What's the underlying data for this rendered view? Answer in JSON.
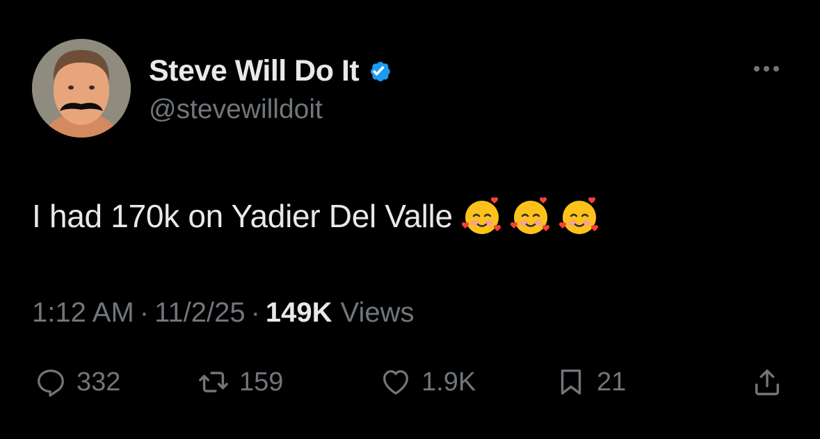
{
  "author": {
    "display_name": "Steve Will Do It",
    "handle": "@stevewilldoit",
    "verified": true,
    "verified_color": "#1d9bf0"
  },
  "tweet": {
    "text": "I had 170k on Yadier Del Valle",
    "emojis": [
      "smiling-face-with-hearts",
      "smiling-face-with-hearts",
      "smiling-face-with-hearts"
    ]
  },
  "meta": {
    "time": "1:12 AM",
    "date": "11/2/25",
    "separator": "·",
    "views_count": "149K",
    "views_label": "Views"
  },
  "actions": {
    "replies": "332",
    "reposts": "159",
    "likes": "1.9K",
    "bookmarks": "21"
  },
  "icons": {
    "reply": "reply-icon",
    "repost": "repost-icon",
    "like": "heart-icon",
    "bookmark": "bookmark-icon",
    "share": "share-icon",
    "more": "more-icon"
  },
  "colors": {
    "background": "#000000",
    "primary_text": "#e7e9ea",
    "secondary_text": "#71767b"
  }
}
